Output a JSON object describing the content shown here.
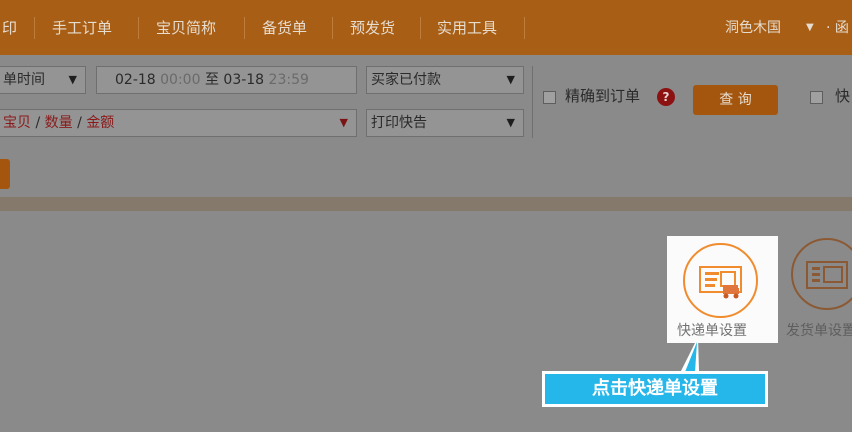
{
  "nav": {
    "items": [
      "印",
      "手工订单",
      "宝贝简称",
      "备货单",
      "预发货",
      "实用工具"
    ],
    "user": "洞色木国",
    "user_rest": "· 函"
  },
  "filters": {
    "time_type": "单时间",
    "date_start": "02-18",
    "time_start": "00:00",
    "date_to": "至",
    "date_end": "03-18",
    "time_end": "23:59",
    "status": "买家已付款",
    "goods_prefix": "宝贝",
    "goods_sep1": " / ",
    "goods_qty": "数量",
    "goods_sep2": " / ",
    "goods_amount": "金额",
    "print_status": "打印快告",
    "exact_label": "精确到订单",
    "query_button": "查 询",
    "help_icon": "?"
  },
  "colors": {
    "accent": "#f08c2e",
    "callout": "#25b6ea"
  },
  "tiles": {
    "express_label": "快递单设置",
    "dispatch_label": "发货单设置"
  },
  "callout": {
    "text": "点击快递单设置"
  }
}
